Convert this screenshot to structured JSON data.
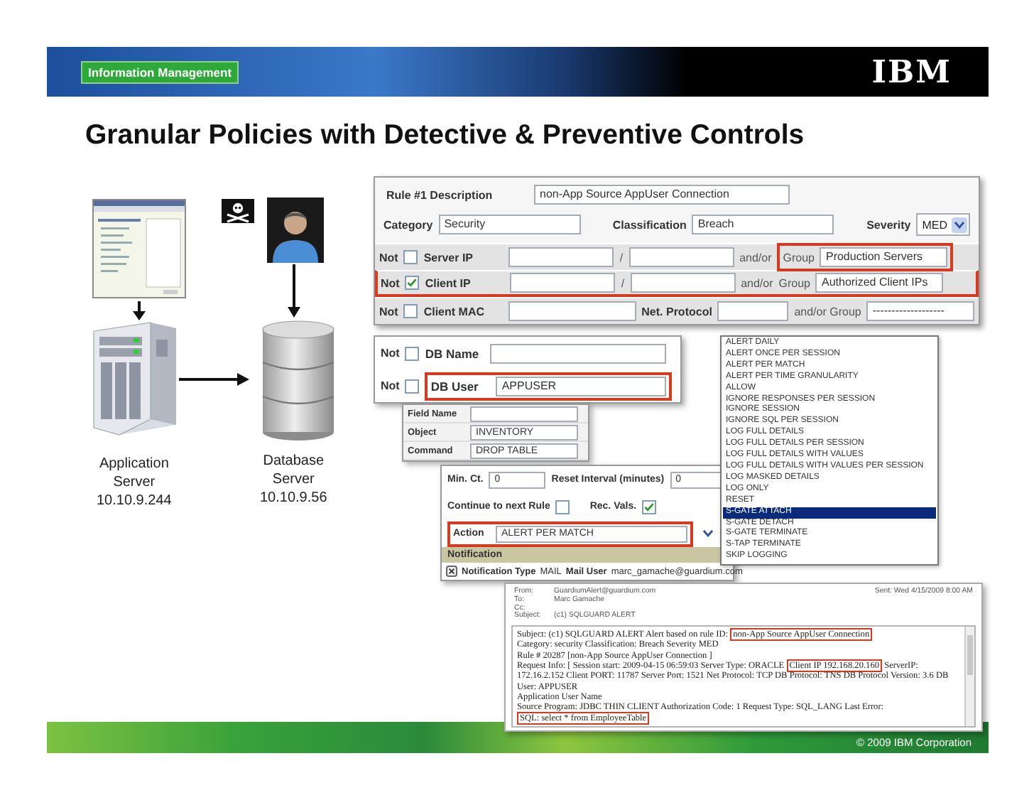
{
  "header": {
    "badge": "Information Management",
    "logo": "IBM"
  },
  "title": "Granular Policies with Detective & Preventive Controls",
  "diagram": {
    "app_server": [
      "Application",
      "Server",
      "10.10.9.244"
    ],
    "db_server": [
      "Database",
      "Server",
      "10.10.9.56"
    ]
  },
  "rule_form": {
    "description_label": "Rule #1 Description",
    "description": "non-App Source AppUser Connection",
    "category_label": "Category",
    "category": "Security",
    "classification_label": "Classification",
    "classification": "Breach",
    "severity_label": "Severity",
    "severity": "MED",
    "filters": [
      {
        "kind": "ip",
        "not_label": "Not",
        "checked": false,
        "label": "Server IP",
        "separator": "/",
        "andor": "and/or",
        "group_label": "Group",
        "group": "Production Servers",
        "group_highlighted": true,
        "row_highlighted": false
      },
      {
        "kind": "ip",
        "not_label": "Not",
        "checked": true,
        "label": "Client IP",
        "separator": "/",
        "andor": "and/or",
        "group_label": "Group",
        "group": "Authorized Client IPs",
        "group_highlighted": false,
        "row_highlighted": true
      },
      {
        "kind": "mac",
        "not_label": "Not",
        "checked": false,
        "label": "Client MAC",
        "protocol_label": "Net. Protocol",
        "group_label": "and/or Group",
        "group": "-------------------",
        "group_highlighted": false,
        "row_highlighted": false
      }
    ]
  },
  "db_panel": {
    "rows": [
      {
        "not_label": "Not",
        "checked": false,
        "label": "DB Name",
        "highlighted": false
      },
      {
        "not_label": "Not",
        "checked": false,
        "label": "DB User",
        "value": "APPUSER",
        "highlighted": true
      }
    ]
  },
  "object_panel": {
    "rows": [
      {
        "label": "Field Name"
      },
      {
        "label": "Object",
        "value": "INVENTORY"
      },
      {
        "label": "Command",
        "value": "DROP TABLE"
      }
    ]
  },
  "action_panel": {
    "min_ct_label": "Min. Ct.",
    "min_ct": "0",
    "reset_label": "Reset Interval (minutes)",
    "reset": "0",
    "continue_label": "Continue to next Rule",
    "continue_checked": false,
    "rec_vals_label": "Rec. Vals.",
    "rec_vals_checked": true,
    "action_label": "Action",
    "action": "ALERT PER MATCH",
    "action_highlighted": true,
    "notification_header": "Notification",
    "notification_type_label": "Notification Type",
    "notification_type": "MAIL",
    "mail_user_label": "Mail User",
    "mail_user": "marc_gamache@guardium.com"
  },
  "action_list": {
    "items": [
      {
        "label": "ALERT DAILY",
        "selected": false
      },
      {
        "label": "ALERT ONCE PER SESSION",
        "selected": false
      },
      {
        "label": "ALERT PER MATCH",
        "selected": false
      },
      {
        "label": "ALERT PER TIME GRANULARITY",
        "selected": false
      },
      {
        "label": "ALLOW",
        "selected": false
      },
      {
        "label": "IGNORE RESPONSES PER SESSION",
        "selected": false
      },
      {
        "label": "IGNORE SESSION",
        "selected": false
      },
      {
        "label": "IGNORE SQL PER SESSION",
        "selected": false
      },
      {
        "label": "LOG FULL DETAILS",
        "selected": false
      },
      {
        "label": "LOG FULL DETAILS PER SESSION",
        "selected": false
      },
      {
        "label": "LOG FULL DETAILS WITH VALUES",
        "selected": false
      },
      {
        "label": "LOG FULL DETAILS WITH VALUES PER SESSION",
        "selected": false
      },
      {
        "label": "LOG MASKED DETAILS",
        "selected": false
      },
      {
        "label": "LOG ONLY",
        "selected": false
      },
      {
        "label": "RESET",
        "selected": false
      },
      {
        "label": "S-GATE ATTACH",
        "selected": true
      },
      {
        "label": "S-GATE DETACH",
        "selected": false
      },
      {
        "label": "S-GATE TERMINATE",
        "selected": false
      },
      {
        "label": "S-TAP TERMINATE",
        "selected": false
      },
      {
        "label": "SKIP LOGGING",
        "selected": false
      }
    ]
  },
  "email": {
    "from_label": "From:",
    "from": "GuardiumAlert@guardium.com",
    "to_label": "To:",
    "to": "Marc Gamache",
    "cc_label": "Cc:",
    "subject_label": "Subject:",
    "subject": "(c1) SQLGUARD ALERT",
    "sent_label": "Sent:",
    "sent": "Wed 4/15/2009 8:00 AM",
    "body": [
      [
        {
          "text": "Subject: (c1) SQLGUARD ALERT Alert based on rule ID: ",
          "boxed": false
        },
        {
          "text": "non-App Source AppUser Connection",
          "boxed": true
        }
      ],
      [
        {
          "text": "Category: security Classification: Breach Severity MED",
          "boxed": false
        }
      ],
      [
        {
          "text": "Rule # 20287 [non-App Source AppUser Connection ]",
          "boxed": false
        }
      ],
      [
        {
          "text": "Request Info: [ Session start: 2009-04-15 06:59:03 Server Type: ORACLE ",
          "boxed": false
        },
        {
          "text": "Client IP 192.168.20.160",
          "boxed": true
        },
        {
          "text": " ServerIP: 172.16.2.152 Client PORT: 11787 Server Port: 1521 Net Protocol: TCP DB Protocol: TNS DB Protocol Version: 3.6 DB User: APPUSER",
          "boxed": false
        }
      ],
      [
        {
          "text": "Application User Name",
          "boxed": false
        }
      ],
      [
        {
          "text": "Source Program: JDBC THIN CLIENT Authorization Code: 1 Request Type: SQL_LANG Last Error:",
          "boxed": false
        }
      ],
      [
        {
          "text": "SQL: select * from EmployeeTable",
          "boxed": true
        }
      ]
    ]
  },
  "footer": {
    "copyright": "© 2009 IBM Corporation"
  }
}
